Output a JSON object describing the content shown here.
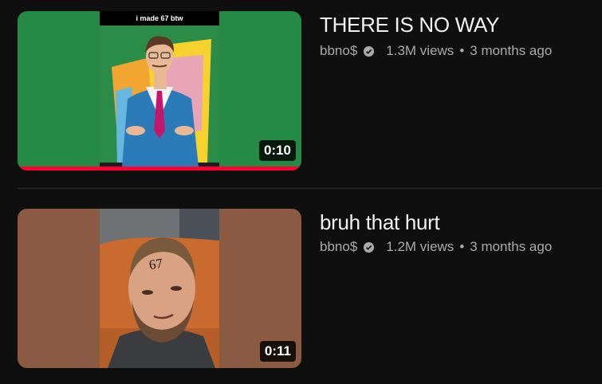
{
  "videos": [
    {
      "title": "THERE IS NO WAY",
      "channel": "bbno$",
      "views": "1.3M views",
      "age": "3 months ago",
      "duration": "0:10",
      "thumbnail_caption": "i made 67 btw",
      "watched_fraction": 1.0,
      "side_color": "#258a45"
    },
    {
      "title": "bruh that hurt",
      "channel": "bbno$",
      "views": "1.2M views",
      "age": "3 months ago",
      "duration": "0:11",
      "side_color": "#8b5a42"
    }
  ],
  "separator": "•",
  "icons": {
    "verified": "verified-badge-icon"
  }
}
